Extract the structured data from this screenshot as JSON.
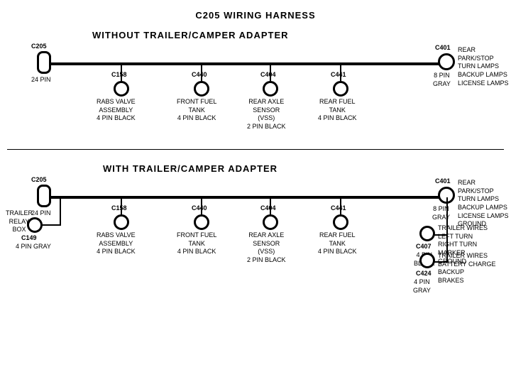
{
  "title": "C205 WIRING HARNESS",
  "section1": {
    "label": "WITHOUT  TRAILER/CAMPER  ADAPTER",
    "left_connector": {
      "id": "C205",
      "pin_label": "24 PIN"
    },
    "right_connector": {
      "id": "C401",
      "pin_label": "8 PIN\nGRAY",
      "desc": "REAR PARK/STOP\nTURN LAMPS\nBACKUP LAMPS\nLICENSE LAMPS"
    },
    "connectors": [
      {
        "id": "C158",
        "desc": "RABS VALVE\nASSEMBLY\n4 PIN BLACK"
      },
      {
        "id": "C440",
        "desc": "FRONT FUEL\nTANK\n4 PIN BLACK"
      },
      {
        "id": "C404",
        "desc": "REAR AXLE\nSENSOR\n(VSS)\n2 PIN BLACK"
      },
      {
        "id": "C441",
        "desc": "REAR FUEL\nTANK\n4 PIN BLACK"
      }
    ]
  },
  "section2": {
    "label": "WITH  TRAILER/CAMPER  ADAPTER",
    "left_connector": {
      "id": "C205",
      "pin_label": "24 PIN"
    },
    "right_connector": {
      "id": "C401",
      "pin_label": "8 PIN\nGRAY",
      "desc": "REAR PARK/STOP\nTURN LAMPS\nBACKUP LAMPS\nLICENSE LAMPS\nGROUND"
    },
    "extra_left": {
      "label": "TRAILER\nRELAY\nBOX",
      "id": "C149",
      "pin_label": "4 PIN GRAY"
    },
    "connectors": [
      {
        "id": "C158",
        "desc": "RABS VALVE\nASSEMBLY\n4 PIN BLACK"
      },
      {
        "id": "C440",
        "desc": "FRONT FUEL\nTANK\n4 PIN BLACK"
      },
      {
        "id": "C404",
        "desc": "REAR AXLE\nSENSOR\n(VSS)\n2 PIN BLACK"
      },
      {
        "id": "C441",
        "desc": "REAR FUEL\nTANK\n4 PIN BLACK"
      }
    ],
    "extra_right_top": {
      "id": "C407",
      "pin_label": "4 PIN\nBLACK",
      "desc": "TRAILER WIRES\nLEFT TURN\nRIGHT TURN\nMARKER\nGROUND"
    },
    "extra_right_bottom": {
      "id": "C424",
      "pin_label": "4 PIN\nGRAY",
      "desc": "TRAILER WIRES\nBATTERY CHARGE\nBACKUP\nBRAKES"
    }
  }
}
